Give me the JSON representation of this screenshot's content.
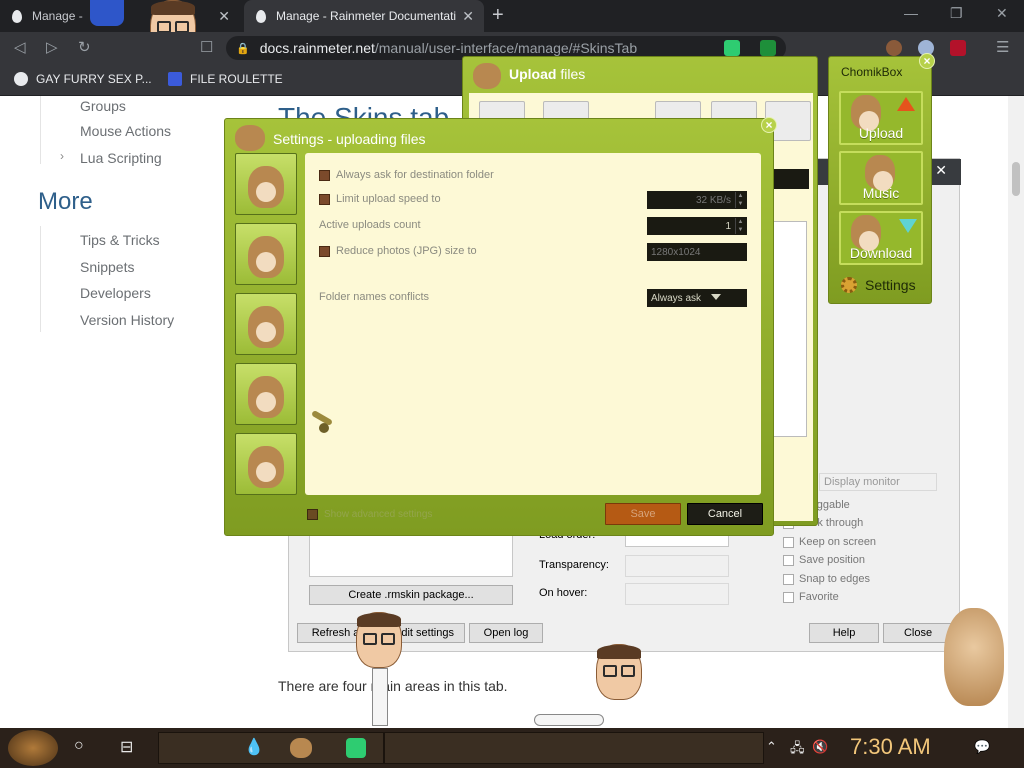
{
  "browser": {
    "tabs": [
      {
        "label": "Manage -",
        "active": false
      },
      {
        "label": "Manage - Rainmeter Documentati",
        "active": true
      }
    ],
    "url_host": "docs.rainmeter.net",
    "url_path": "/manual/user-interface/manage/#SkinsTab",
    "bookmarks": [
      "GAY FURRY SEX P...",
      "FILE ROULETTE"
    ]
  },
  "sidebar": {
    "items_top": [
      "Groups",
      "Mouse Actions",
      "Lua Scripting"
    ],
    "heading": "More",
    "items_more": [
      "Tips & Tricks",
      "Snippets",
      "Developers",
      "Version History"
    ]
  },
  "page": {
    "title": "The Skins tab",
    "paragraph": "There are four main areas in this tab."
  },
  "rainmeter": {
    "create_package": "Create .rmskin package...",
    "labels": {
      "load_order": "Load order:",
      "transparency": "Transparency:",
      "on_hover": "On hover:"
    },
    "display_monitor": "Display monitor",
    "checks": [
      "Draggable",
      "Click through",
      "Keep on screen",
      "Save position",
      "Snap to edges",
      "Favorite"
    ],
    "buttons": {
      "refresh_all": "Refresh all",
      "edit_settings": "Edit settings",
      "open_log": "Open log",
      "help": "Help",
      "close": "Close"
    }
  },
  "upload_window": {
    "title_bold": "Upload",
    "title_rest": " files"
  },
  "chomikbox": {
    "title": "ChomikBox",
    "buttons": [
      "Upload",
      "Music",
      "Download"
    ],
    "settings": "Settings"
  },
  "settings_window": {
    "title": "Settings - uploading files",
    "ask_destination": "Always ask for destination folder",
    "limit_upload": "Limit upload speed to",
    "upload_speed": "32 KB/s",
    "active_uploads": "Active uploads count",
    "active_uploads_value": "1",
    "reduce_photos": "Reduce photos (JPG) size to",
    "photo_size": "1280x1024",
    "folder_conflicts": "Folder names conflicts",
    "folder_conflicts_value": "Always ask",
    "show_advanced": "Show advanced settings",
    "save": "Save",
    "cancel": "Cancel"
  },
  "taskbar": {
    "time": "7:30 AM"
  },
  "colors": {
    "chrome_dark": "#202124",
    "chrome_mid": "#35363a",
    "link_blue": "#2e5f8a",
    "chomik_green": "#8fae2c",
    "panel_cream": "#fdf9d6",
    "clock_gold": "#f2c67a"
  }
}
